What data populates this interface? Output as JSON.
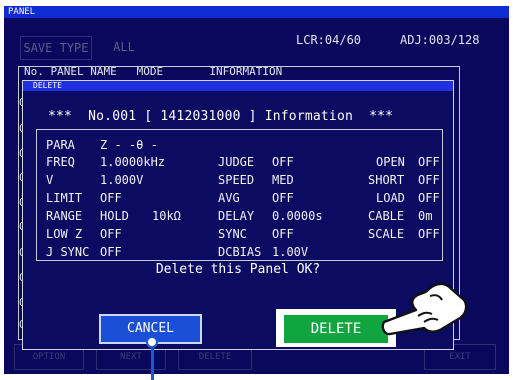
{
  "window": {
    "title": "PANEL"
  },
  "toolbar": {
    "save_type_label": "SAVE TYPE",
    "all_label": "ALL"
  },
  "status": {
    "lcr": "LCR:04/60",
    "adj": "ADJ:003/128"
  },
  "list": {
    "header": "No. PANEL NAME   MODE       INFORMATION",
    "row_marker": "O"
  },
  "bottom_bar": [
    "OPTION",
    "NEXT",
    "DELETE",
    "EXIT"
  ],
  "dialog": {
    "title": "DELETE",
    "heading": "***  No.001 [ 1412031000 ] Information  ***",
    "params": {
      "para_label": "PARA",
      "para_value": "Z - -θ -",
      "freq_label": "FREQ",
      "freq_value": "1.0000kHz",
      "v_label": "V",
      "v_value": "1.000V",
      "limit_label": "LIMIT",
      "limit_value": "OFF",
      "range_label": "RANGE",
      "range_value": "HOLD",
      "range_extra": "10kΩ",
      "lowz_label": "LOW Z",
      "lowz_value": "OFF",
      "jsync_label": "J SYNC",
      "jsync_value": "OFF",
      "judge_label": "JUDGE",
      "judge_value": "OFF",
      "speed_label": "SPEED",
      "speed_value": "MED",
      "avg_label": "AVG",
      "avg_value": "OFF",
      "delay_label": "DELAY",
      "delay_value": "0.0000s",
      "sync_label": "SYNC",
      "sync_value": "OFF",
      "dcbias_label": "DCBIAS",
      "dcbias_value": "1.00V",
      "open_label": "OPEN",
      "open_value": "OFF",
      "short_label": "SHORT",
      "short_value": "OFF",
      "load_label": "LOAD",
      "load_value": "OFF",
      "cable_label": "CABLE",
      "cable_value": "0m",
      "scale_label": "SCALE",
      "scale_value": "OFF"
    },
    "question": "Delete this Panel OK?",
    "cancel_label": "CANCEL",
    "delete_label": "DELETE"
  },
  "colors": {
    "screen_bg": "#09085c",
    "dialog_bg": "#0c0b62",
    "titlebar": "#0f2bd2",
    "cancel_button": "#1b4fd8",
    "delete_button": "#11a53f",
    "callout": "#1f58c8"
  },
  "icons": {
    "hand_pointer": "pointing-hand-icon"
  }
}
